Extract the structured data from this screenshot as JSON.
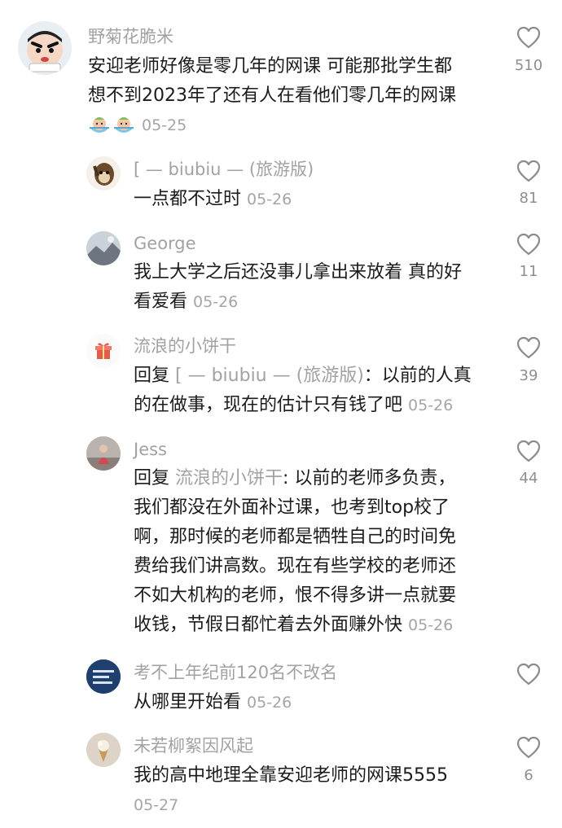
{
  "comments": [
    {
      "username": "野菊花脆米",
      "lines": [
        "安迎老师好像是零几年的网课 可能那批学生都",
        "想不到2023年了还有人在看他们零几年的网课"
      ],
      "emoji": [
        "peach-bath-emoji",
        "peach-bath-emoji"
      ],
      "date": "05-25",
      "likes": "510"
    },
    {
      "username": "[ — biubiu — (旅游版)",
      "lines": [
        "一点都不过时"
      ],
      "date": "05-26",
      "likes": "81"
    },
    {
      "username": "George",
      "lines": [
        "我上大学之后还没事儿拿出来放着 真的好",
        "看爱看"
      ],
      "date": "05-26",
      "likes": "11"
    },
    {
      "username": "流浪的小饼干",
      "reply_prefix": "回复",
      "reply_target": "[ — biubiu — (旅游版)",
      "lines": [
        "：以前的人真",
        "的在做事，现在的估计只有钱了吧"
      ],
      "date": "05-26",
      "likes": "39"
    },
    {
      "username": "Jess",
      "reply_prefix": "回复",
      "reply_target": "流浪的小饼干",
      "lines": [
        ": 以前的老师多负责，",
        "我们都没在外面补过课，也考到top校了",
        "啊，那时候的老师都是牺牲自己的时间免",
        "费给我们讲高数。现在有些学校的老师还",
        "不如大机构的老师，恨不得多讲一点就要",
        "收钱，节假日都忙着去外面赚外快"
      ],
      "date": "05-26",
      "likes": "44"
    },
    {
      "username": "考不上年纪前120名不改名",
      "lines": [
        "从哪里开始看"
      ],
      "date": "05-26",
      "likes": ""
    },
    {
      "username": "未若柳絮因风起",
      "lines": [
        "我的高中地理全靠安迎老师的网课5555"
      ],
      "date": "05-27",
      "likes": "6"
    }
  ],
  "icons": {
    "like": "heart-outline-icon"
  },
  "colors": {
    "username": "#a2a2a2",
    "text": "#1b1b1b",
    "date": "#a5a5a5",
    "heart": "#8c8c8c"
  }
}
